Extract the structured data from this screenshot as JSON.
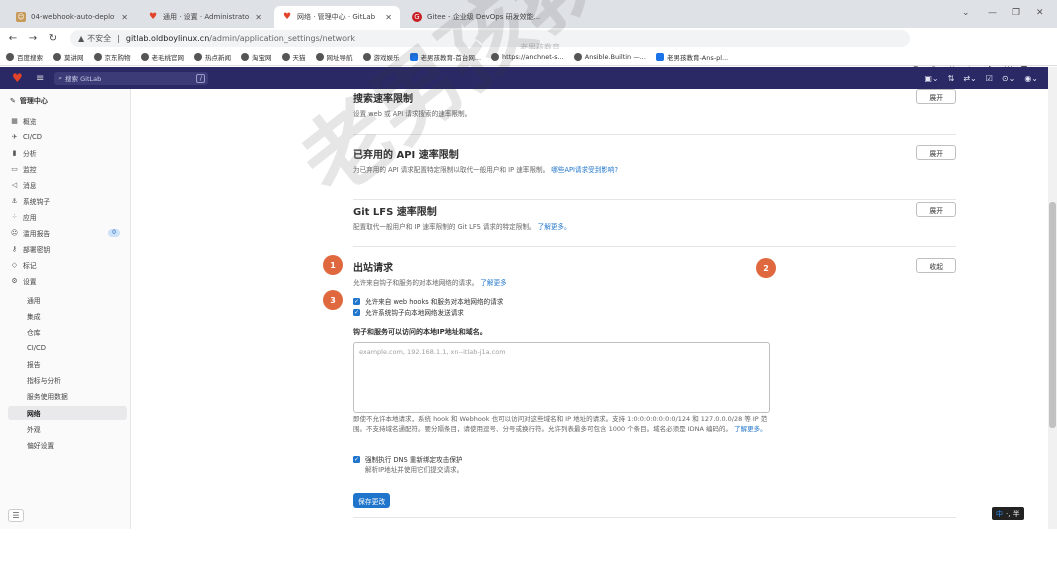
{
  "browser": {
    "tabs": [
      {
        "title": "04-webhook-auto-deploy-co...",
        "icon": "gitlab-user-icon",
        "active": false
      },
      {
        "title": "通用 · 设置 · Administrator / ba...",
        "icon": "gitlab-icon",
        "active": false
      },
      {
        "title": "网络 · 管理中心 · GitLab",
        "icon": "gitlab-icon",
        "active": true
      },
      {
        "title": "Gitee - 企业级 DevOps 研发效能...",
        "icon": "gitee-icon",
        "active": false
      }
    ],
    "url": {
      "security": "不安全",
      "host": "gitlab.oldboylinux.cn",
      "path": "/admin/application_settings/network"
    },
    "bookmarks": [
      "百度搜索",
      "莫讲网",
      "京东购物",
      "老毛桃官网",
      "热点新闻",
      "淘宝网",
      "天猫",
      "网址导航",
      "游戏娱乐",
      "老男孩教育-首台网...",
      "https://anchnet-s...",
      "Ansible.Builtin —...",
      "老男孩教育-Ans-pl..."
    ],
    "overlay_text": "老男孩教育"
  },
  "topbar": {
    "search_placeholder": "搜索 GitLab",
    "search_shortcut": "/",
    "brand_color": "#2a2966"
  },
  "sidebar": {
    "title": "管理中心",
    "items": [
      {
        "label": "概览",
        "icon": "grid-icon"
      },
      {
        "label": "CI/CD",
        "icon": "rocket-icon"
      },
      {
        "label": "分析",
        "icon": "chart-icon"
      },
      {
        "label": "监控",
        "icon": "monitor-icon"
      },
      {
        "label": "消息",
        "icon": "megaphone-icon"
      },
      {
        "label": "系统钩子",
        "icon": "hook-icon"
      },
      {
        "label": "应用",
        "icon": "apps-icon"
      },
      {
        "label": "滥用报告",
        "icon": "abuse-icon",
        "badge": "0"
      },
      {
        "label": "部署密钥",
        "icon": "key-icon"
      },
      {
        "label": "标记",
        "icon": "label-icon"
      },
      {
        "label": "设置",
        "icon": "gear-icon"
      }
    ],
    "subitems": [
      "通用",
      "集成",
      "仓库",
      "CI/CD",
      "报告",
      "指标与分析",
      "服务使用数据",
      "网络",
      "外观",
      "偏好设置"
    ],
    "active": "网络"
  },
  "main": {
    "sections": [
      {
        "title": "搜索速率限制",
        "desc": "设置 web 或 API 请求搜索的速率限制。",
        "button": "展开"
      },
      {
        "title": "已弃用的 API 速率限制",
        "desc": "为已弃用的 API 请求配置特定限制以取代一般用户和 IP 速率限制。",
        "link": "哪些API请求受到影响?",
        "button": "展开"
      },
      {
        "title": "Git LFS 速率限制",
        "desc": "配置取代一般用户和 IP 速率限制的 Git LFS 请求的特定限制。",
        "link": "了解更多。",
        "button": "展开"
      }
    ],
    "outbound": {
      "title": "出站请求",
      "desc": "允许来自钩子和服务的对本地网络的请求。",
      "link": "了解更多",
      "button": "收起",
      "checkboxes": [
        {
          "label": "允许来自 web hooks 和服务对本地网络的请求",
          "checked": true
        },
        {
          "label": "允许系统钩子向本地网络发送请求",
          "checked": true
        }
      ],
      "field_label": "钩子和服务可以访问的本地IP地址和域名。",
      "textarea_placeholder": "example.com, 192.168.1.1, xn--itlab-j1a.com",
      "help_text": "即使不允许本地请求，系统 hook 和 Webhook 也可以访问对这些域名和 IP 地址的请求。支持 1:0:0:0:0:0:0:0/124 和 127.0.0.0/28 等 IP 范围。不支持域名通配符。要分隔条目，请使用逗号、分号或换行符。允许列表最多可包含 1000 个条目。域名必须是 IDNA 编码的。",
      "help_link": "了解更多。",
      "dns_checkbox": {
        "label": "强制执行 DNS 重新绑定攻击保护",
        "sub": "解析IP地址并使用它们提交请求。",
        "checked": true
      },
      "save_button": "保存更改"
    },
    "markers": [
      "1",
      "2",
      "3"
    ],
    "marker_color": "#e0683f",
    "accent_color": "#1f75cb"
  },
  "watermark": "老男孩教育",
  "ime": {
    "lang": "中",
    "mode": "·, 半"
  }
}
